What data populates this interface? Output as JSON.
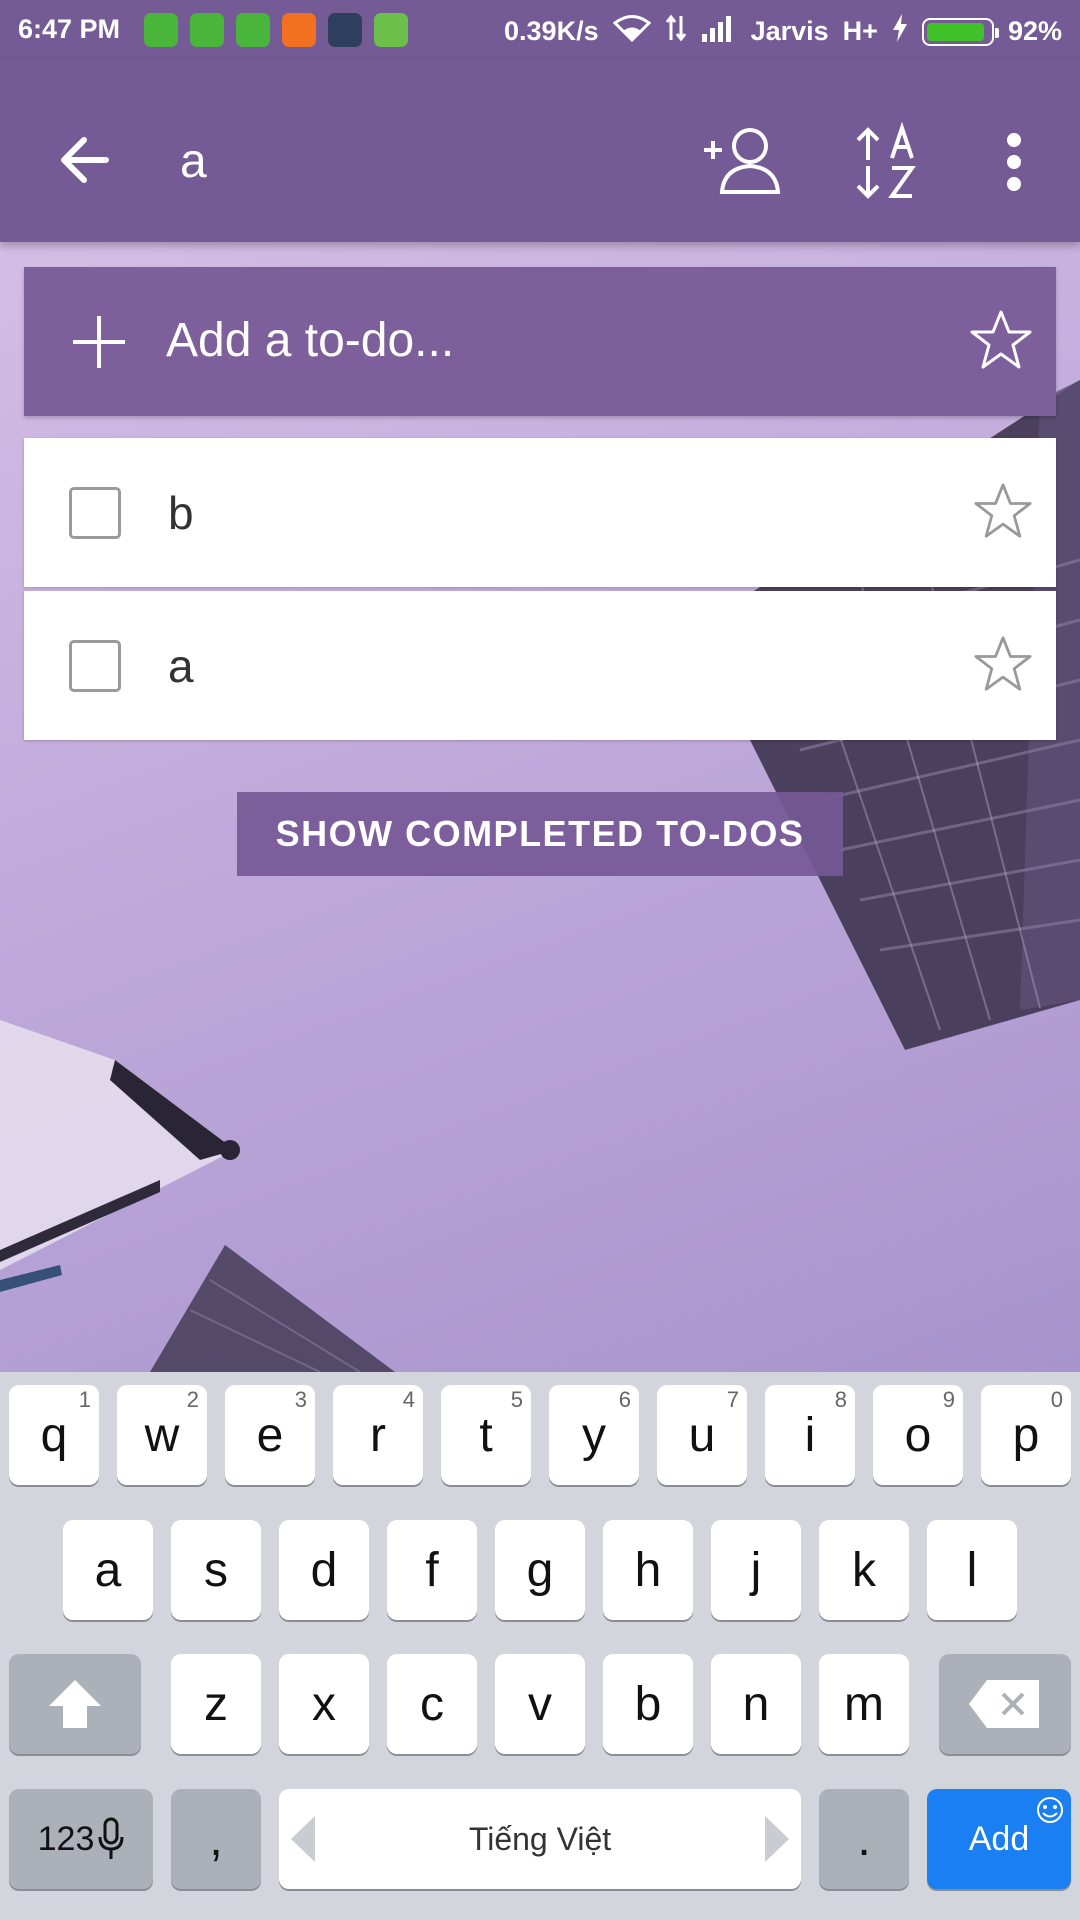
{
  "status_bar": {
    "time": "6:47 PM",
    "network_speed": "0.39K/s",
    "carrier": "Jarvis",
    "network_type": "H+",
    "battery_percent": "92%",
    "battery_level": 0.92,
    "notification_icons": [
      "android-icon",
      "android-icon",
      "android-icon",
      "mi-icon",
      "puzzle-icon",
      "battery-saver-icon"
    ]
  },
  "app_bar": {
    "title": "a",
    "icons": [
      "back-arrow-icon",
      "add-person-icon",
      "sort-az-icon",
      "more-vert-icon"
    ]
  },
  "add_todo": {
    "placeholder": "Add a to-do..."
  },
  "tasks": [
    {
      "title": "b",
      "completed": false,
      "starred": false
    },
    {
      "title": "a",
      "completed": false,
      "starred": false
    }
  ],
  "show_completed_label": "SHOW COMPLETED TO-DOS",
  "keyboard": {
    "row1": [
      {
        "key": "q",
        "hint": "1"
      },
      {
        "key": "w",
        "hint": "2"
      },
      {
        "key": "e",
        "hint": "3"
      },
      {
        "key": "r",
        "hint": "4"
      },
      {
        "key": "t",
        "hint": "5"
      },
      {
        "key": "y",
        "hint": "6"
      },
      {
        "key": "u",
        "hint": "7"
      },
      {
        "key": "i",
        "hint": "8"
      },
      {
        "key": "o",
        "hint": "9"
      },
      {
        "key": "p",
        "hint": "0"
      }
    ],
    "row2": [
      "a",
      "s",
      "d",
      "f",
      "g",
      "h",
      "j",
      "k",
      "l"
    ],
    "row3": [
      "z",
      "x",
      "c",
      "v",
      "b",
      "n",
      "m"
    ],
    "numbers_label": "123",
    "comma": ",",
    "space_label": "Tiếng Việt",
    "period": ".",
    "action_label": "Add"
  },
  "colors": {
    "app_bar": "#755b95",
    "add_bar": "#7d5f9c",
    "action_key": "#1a7ff3"
  }
}
